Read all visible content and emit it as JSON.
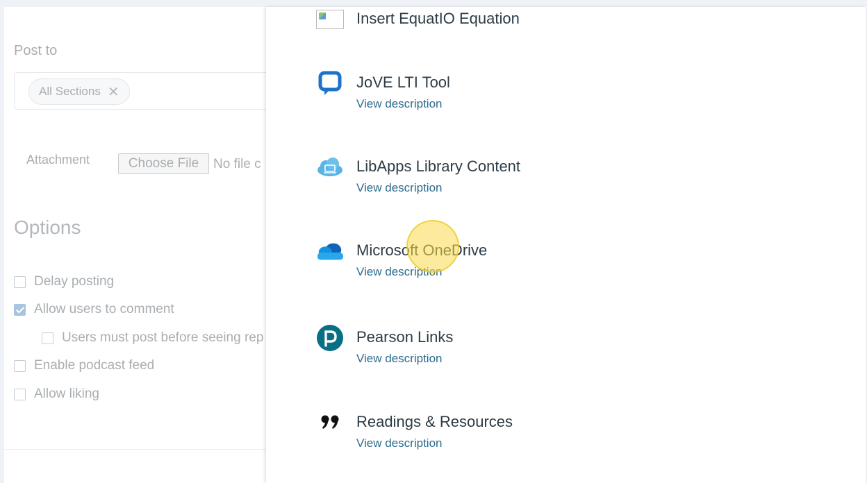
{
  "form": {
    "post_to_label": "Post to",
    "section_pill": "All Sections",
    "section_pill_remove": "✕",
    "attachment_label": "Attachment",
    "choose_file_label": "Choose File",
    "no_file_text": "No file c",
    "options_title": "Options",
    "options": {
      "delay_posting": {
        "label": "Delay posting",
        "checked": false
      },
      "allow_comment": {
        "label": "Allow users to comment",
        "checked": true
      },
      "must_post": {
        "label": "Users must post before seeing rep",
        "checked": false
      },
      "podcast": {
        "label": "Enable podcast feed",
        "checked": false
      },
      "liking": {
        "label": "Allow liking",
        "checked": false
      }
    }
  },
  "tray": {
    "tools": [
      {
        "name": "Insert EquatIO Equation",
        "icon": "broken-image-icon"
      },
      {
        "name": "JoVE LTI Tool",
        "desc": "View description",
        "icon": "speech-bubble-icon"
      },
      {
        "name": "LibApps Library Content",
        "desc": "View description",
        "icon": "cloud-laptop-icon"
      },
      {
        "name": "Microsoft OneDrive",
        "desc": "View description",
        "icon": "onedrive-cloud-icon"
      },
      {
        "name": "Pearson Links",
        "desc": "View description",
        "icon": "pearson-logo-icon"
      },
      {
        "name": "Readings & Resources",
        "desc": "View description",
        "icon": "quote-marks-icon"
      }
    ]
  },
  "colors": {
    "tool_name": "#2d3b45",
    "link": "#2b6a8a",
    "jove_blue": "#1d72c9",
    "onedrive_blue": "#0f78d4",
    "pearson_teal": "#0a6f84"
  }
}
